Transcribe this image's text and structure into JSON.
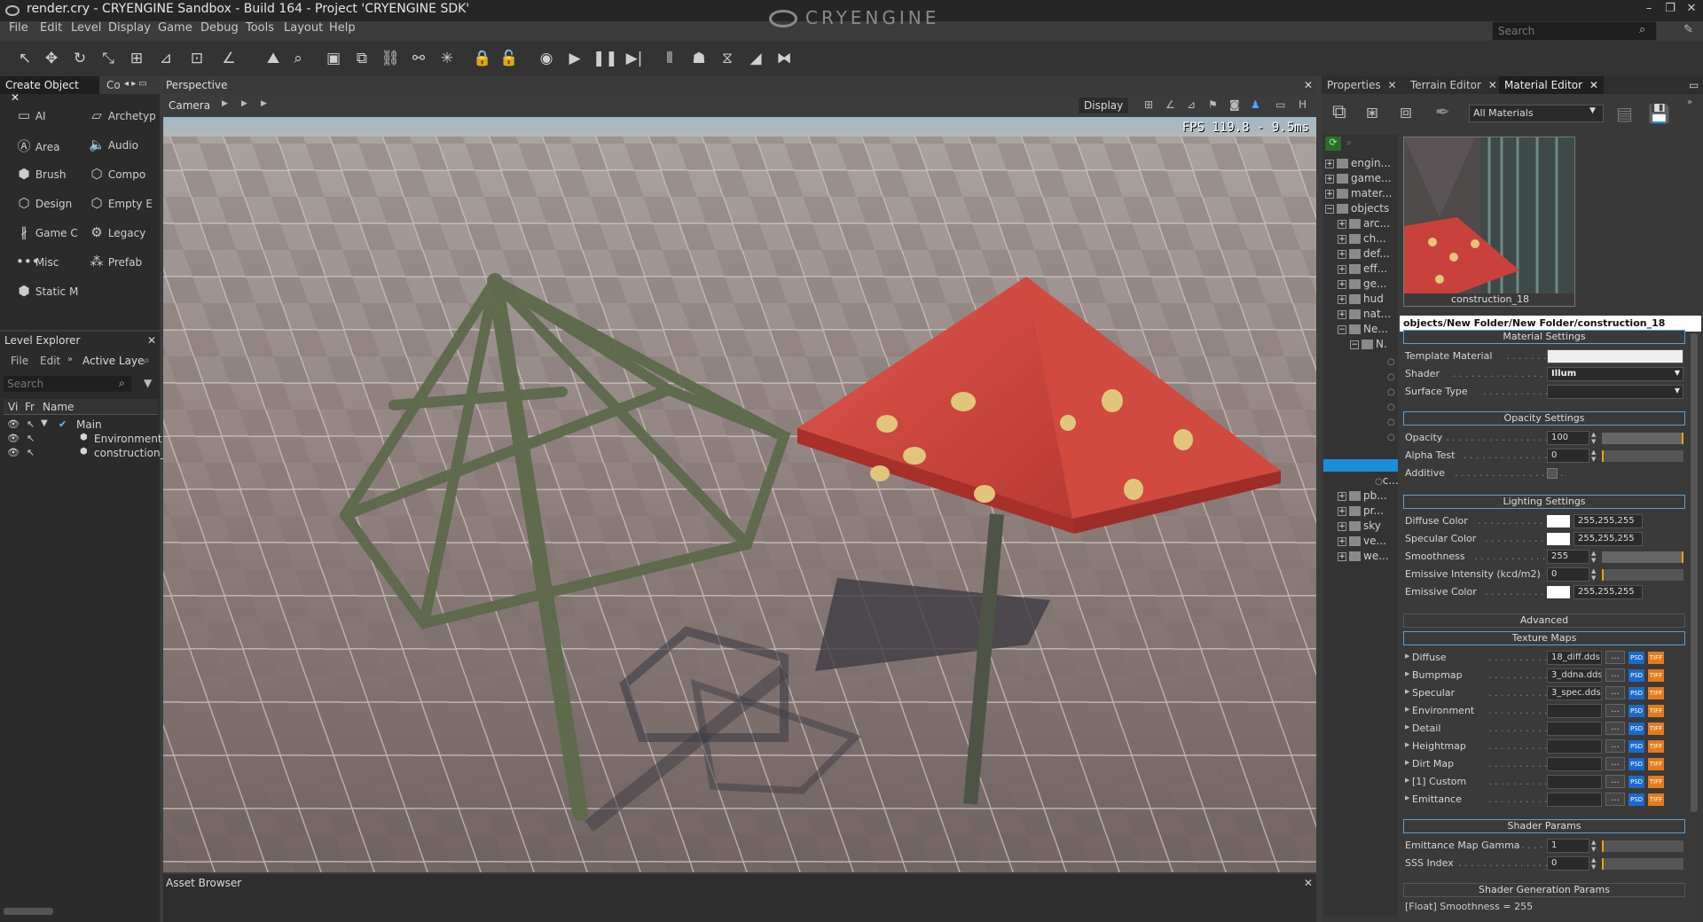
{
  "window": {
    "title": "render.cry - CRYENGINE Sandbox - Build 164 - Project 'CRYENGINE SDK'",
    "logo": "CRYENGINE"
  },
  "search": {
    "placeholder": "Search"
  },
  "menu": [
    "File",
    "Edit",
    "Level",
    "Display",
    "Game",
    "Debug",
    "Tools",
    "Layout",
    "Help"
  ],
  "create_object": {
    "tabs": [
      "Create Object",
      "Co"
    ],
    "items": [
      "AI",
      "Archetyp",
      "Area",
      "Audio",
      "Brush",
      "Compo",
      "Design",
      "Empty E",
      "Game C",
      "Legacy",
      "Misc",
      "Prefab",
      "Static M"
    ]
  },
  "level_explorer": {
    "title": "Level Explorer",
    "menu": [
      "File",
      "Edit"
    ],
    "layer_label": "Active Laye",
    "search_placeholder": "Search",
    "columns": [
      "Vi",
      "Fr",
      "Name"
    ],
    "items": [
      "Main",
      "Environment",
      "construction_"
    ]
  },
  "viewport": {
    "title": "Perspective",
    "camera_label": "Camera",
    "display_label": "Display",
    "h_label": "H",
    "fps": "FPS 119.8 - 9.5ms"
  },
  "asset_browser": {
    "title": "Asset Browser"
  },
  "right_tabs": [
    "Properties",
    "Terrain Editor",
    "Material Editor"
  ],
  "material_editor": {
    "filter": "All Materials",
    "preview_name": "construction_18",
    "path": "objects/New Folder/New Folder/construction_18",
    "tree": [
      "engin...",
      "game...",
      "mater...",
      "objects",
      "arc...",
      "ch...",
      "def...",
      "eff...",
      "ge...",
      "hud",
      "nat...",
      "Ne...",
      "N.",
      "c...",
      "pb...",
      "pr...",
      "sky",
      "ve...",
      "we..."
    ],
    "sections": {
      "material_settings": "Material Settings",
      "opacity_settings": "Opacity Settings",
      "lighting_settings": "Lighting Settings",
      "advanced": "Advanced",
      "texture_maps": "Texture Maps",
      "shader_params": "Shader Params",
      "shader_generation_params": "Shader Generation Params"
    },
    "material": [
      {
        "label": "Template Material",
        "value": ""
      },
      {
        "label": "Shader",
        "value": "Illum"
      },
      {
        "label": "Surface Type",
        "value": ""
      }
    ],
    "opacity": [
      {
        "label": "Opacity",
        "value": "100"
      },
      {
        "label": "Alpha Test",
        "value": "0"
      },
      {
        "label": "Additive",
        "value": ""
      }
    ],
    "lighting": [
      {
        "label": "Diffuse Color",
        "value": "255,255,255"
      },
      {
        "label": "Specular Color",
        "value": "255,255,255"
      },
      {
        "label": "Smoothness",
        "value": "255"
      },
      {
        "label": "Emissive Intensity (kcd/m2)",
        "value": "0"
      },
      {
        "label": "Emissive Color",
        "value": "255,255,255"
      }
    ],
    "textures": [
      {
        "label": "Diffuse",
        "value": "18_diff.dds"
      },
      {
        "label": "Bumpmap",
        "value": "3_ddna.dds"
      },
      {
        "label": "Specular",
        "value": "3_spec.dds"
      },
      {
        "label": "Environment",
        "value": ""
      },
      {
        "label": "Detail",
        "value": ""
      },
      {
        "label": "Heightmap",
        "value": ""
      },
      {
        "label": "Dirt Map",
        "value": ""
      },
      {
        "label": "[1] Custom",
        "value": ""
      },
      {
        "label": "Emittance",
        "value": ""
      }
    ],
    "shader_params": [
      {
        "label": "Emittance Map Gamma",
        "value": "1"
      },
      {
        "label": "SSS Index",
        "value": "0"
      }
    ],
    "status": "[Float] Smoothness = 255",
    "button_dots": "...",
    "psd": "PSD",
    "tif": "TIFF"
  }
}
